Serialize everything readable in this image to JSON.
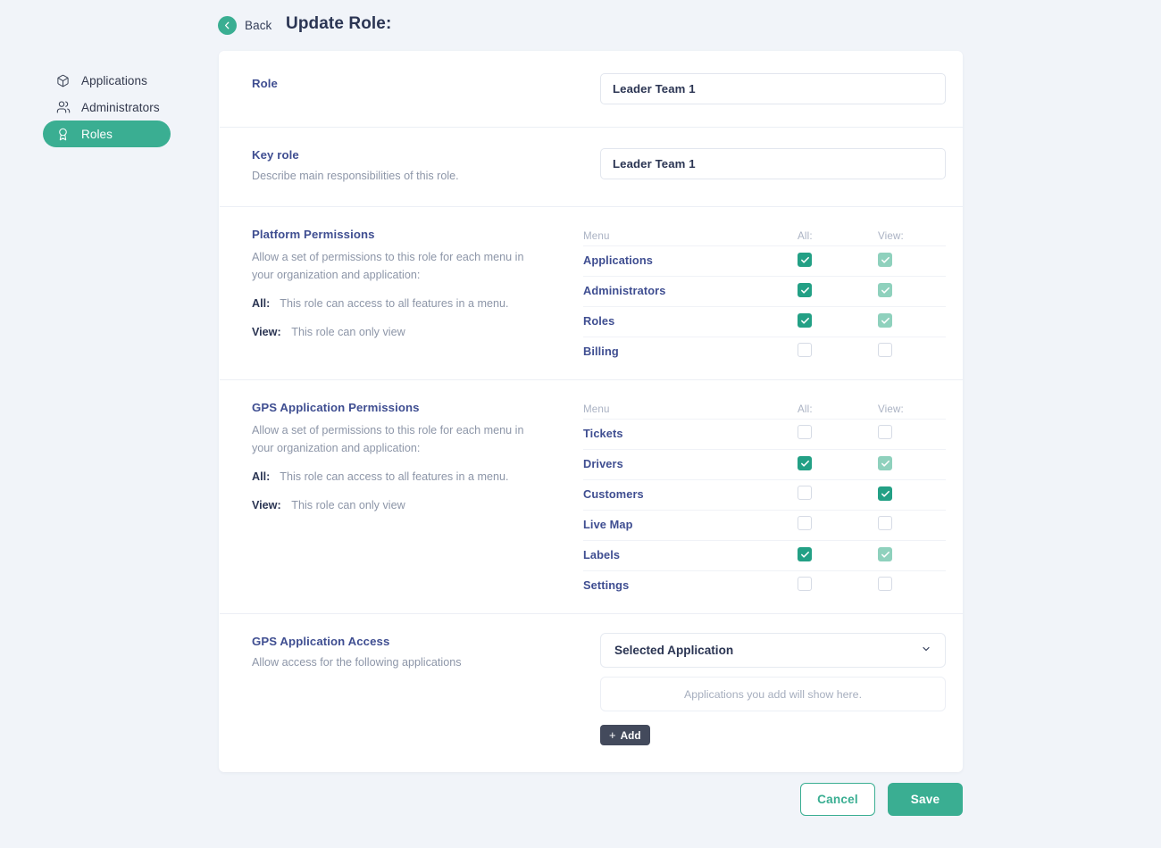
{
  "header": {
    "back_label": "Back",
    "title": "Update Role:",
    "back_icon": "chevron-left-icon"
  },
  "sidebar": {
    "items": [
      {
        "label": "Applications",
        "icon": "package-icon",
        "active": false
      },
      {
        "label": "Administrators",
        "icon": "users-icon",
        "active": false
      },
      {
        "label": "Roles",
        "icon": "award-icon",
        "active": true
      }
    ]
  },
  "sections": {
    "role": {
      "title": "Role",
      "value": "Leader Team 1"
    },
    "key_role": {
      "title": "Key role",
      "description": "Describe main responsibilities of this role.",
      "value": "Leader Team 1"
    },
    "platform_permissions": {
      "title": "Platform Permissions",
      "description": "Allow a set of permissions to this role for each menu in your organization and application:",
      "legend_all_key": "All:",
      "legend_all_text": "This role can access to all features in a menu.",
      "legend_view_key": "View:",
      "legend_view_text": "This role can only view",
      "columns": {
        "menu": "Menu",
        "all": "All:",
        "view": "View:"
      },
      "rows": [
        {
          "menu": "Applications",
          "all": "checked",
          "view": "checked-disabled"
        },
        {
          "menu": "Administrators",
          "all": "checked",
          "view": "checked-disabled"
        },
        {
          "menu": "Roles",
          "all": "checked",
          "view": "checked-disabled"
        },
        {
          "menu": "Billing",
          "all": "unchecked",
          "view": "unchecked"
        }
      ]
    },
    "gps_permissions": {
      "title": "GPS Application Permissions",
      "description": "Allow a set of permissions to this role for each menu in your organization and application:",
      "legend_all_key": "All:",
      "legend_all_text": "This role can access to all features in a menu.",
      "legend_view_key": "View:",
      "legend_view_text": "This role can only view",
      "columns": {
        "menu": "Menu",
        "all": "All:",
        "view": "View:"
      },
      "rows": [
        {
          "menu": "Tickets",
          "all": "unchecked",
          "view": "unchecked"
        },
        {
          "menu": "Drivers",
          "all": "checked",
          "view": "checked-disabled"
        },
        {
          "menu": "Customers",
          "all": "unchecked",
          "view": "checked"
        },
        {
          "menu": "Live Map",
          "all": "unchecked",
          "view": "unchecked"
        },
        {
          "menu": "Labels",
          "all": "checked",
          "view": "checked-disabled"
        },
        {
          "menu": "Settings",
          "all": "unchecked",
          "view": "unchecked"
        }
      ]
    },
    "gps_access": {
      "title": "GPS Application Access",
      "description": "Allow access for the following applications",
      "select_value": "Selected Application",
      "empty_text": "Applications you add will show here.",
      "add_label": "Add",
      "add_plus": "+"
    }
  },
  "footer": {
    "cancel_label": "Cancel",
    "save_label": "Save"
  },
  "colors": {
    "accent": "#3aae92",
    "checkbox_on": "#23a085",
    "checkbox_dim": "#8fd1bd",
    "label_indigo": "#3f4e91",
    "page_bg": "#f1f4f9",
    "add_button": "#434a5c"
  }
}
